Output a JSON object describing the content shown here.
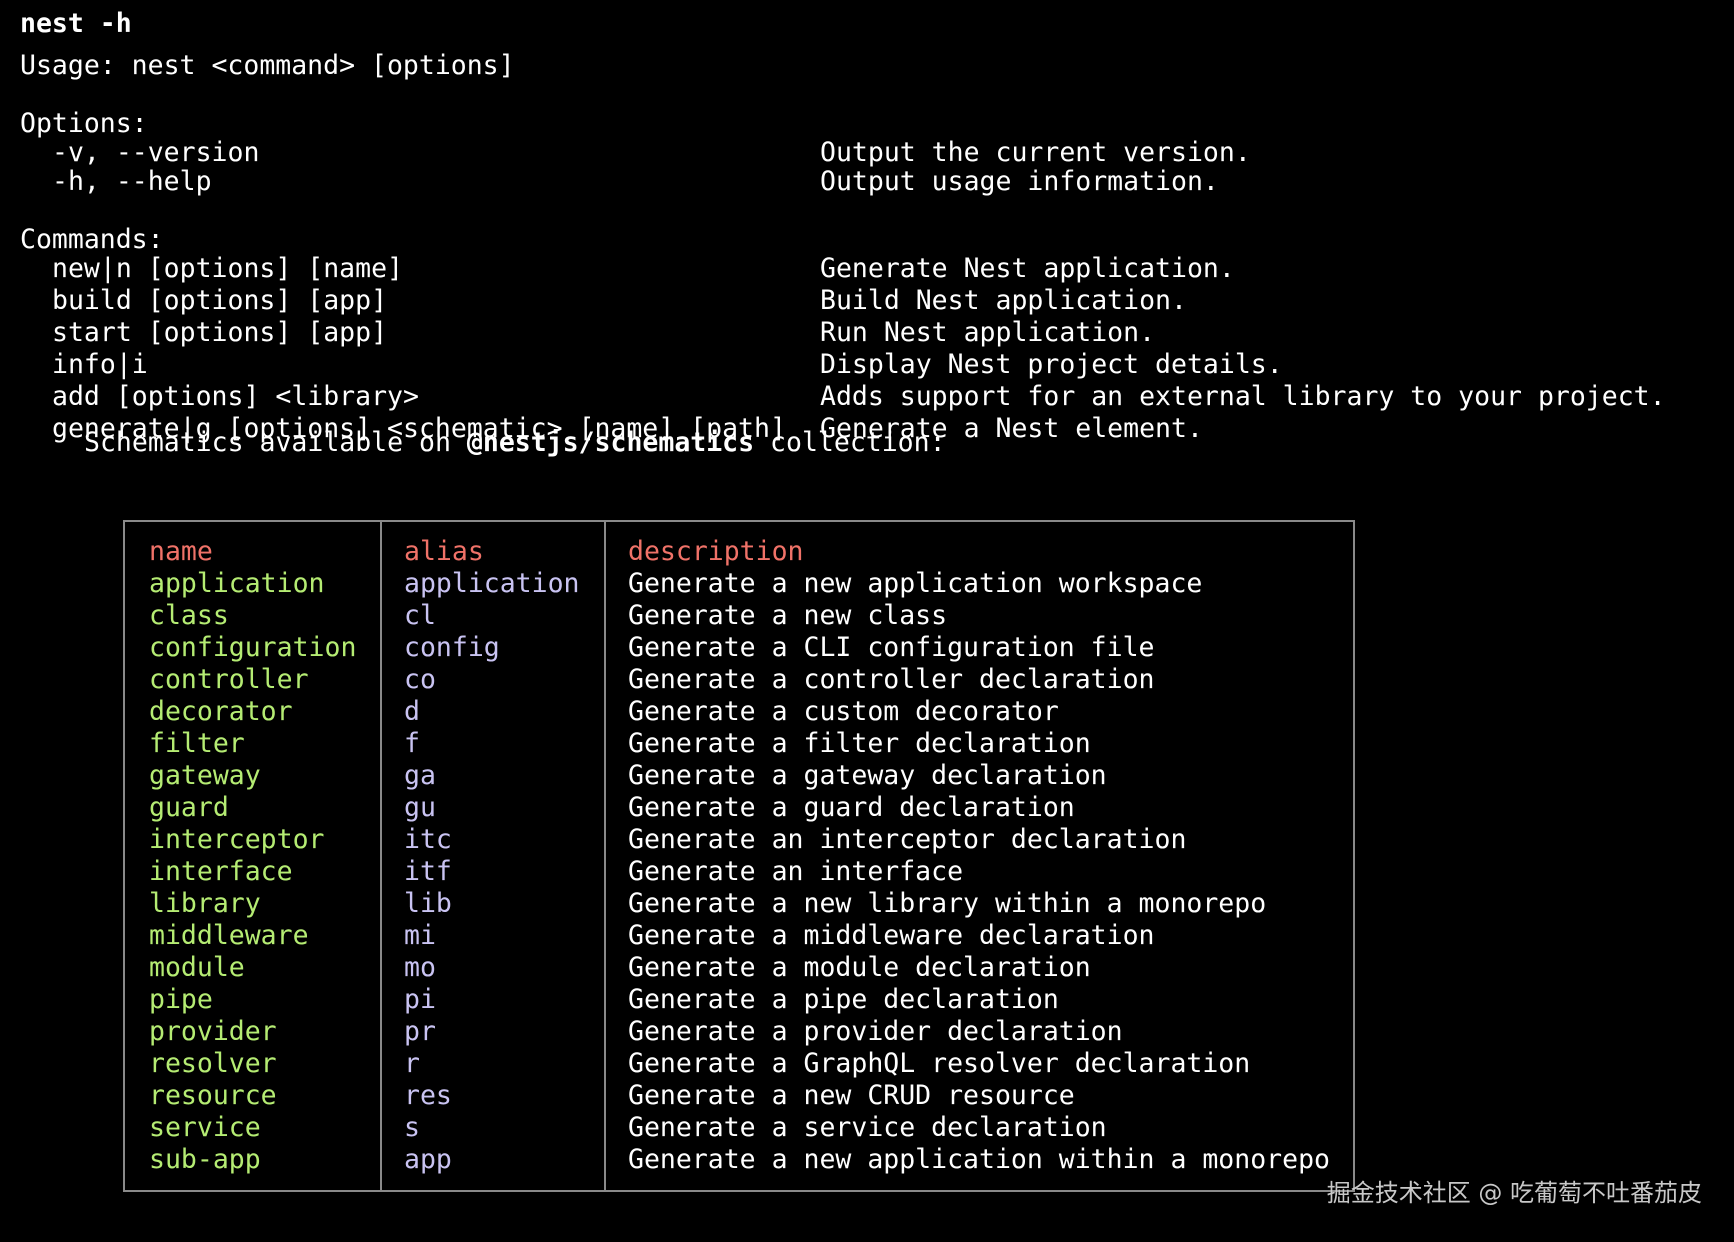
{
  "command": "nest -h",
  "usage": "Usage: nest <command> [options]",
  "options_header": "Options:",
  "options": [
    {
      "flag": "-v, --version",
      "description": "Output the current version."
    },
    {
      "flag": "-h, --help",
      "description": "Output usage information."
    }
  ],
  "commands_header": "Commands:",
  "commands": [
    {
      "usage": "new|n [options] [name]",
      "description": "Generate Nest application."
    },
    {
      "usage": "build [options] [app]",
      "description": "Build Nest application."
    },
    {
      "usage": "start [options] [app]",
      "description": "Run Nest application."
    },
    {
      "usage": "info|i",
      "description": "Display Nest project details."
    },
    {
      "usage": "add [options] <library>",
      "description": "Adds support for an external library to your project."
    },
    {
      "usage": "generate|g [options] <schematic> [name] [path]",
      "description": "Generate a Nest element."
    }
  ],
  "schematics_note": {
    "prefix": "Schematics available on ",
    "collection": "@nestjs/schematics",
    "suffix": " collection:"
  },
  "schematics_table": {
    "headers": {
      "name": "name",
      "alias": "alias",
      "description": "description"
    },
    "rows": [
      {
        "name": "application",
        "alias": "application",
        "description": "Generate a new application workspace"
      },
      {
        "name": "class",
        "alias": "cl",
        "description": "Generate a new class"
      },
      {
        "name": "configuration",
        "alias": "config",
        "description": "Generate a CLI configuration file"
      },
      {
        "name": "controller",
        "alias": "co",
        "description": "Generate a controller declaration"
      },
      {
        "name": "decorator",
        "alias": "d",
        "description": "Generate a custom decorator"
      },
      {
        "name": "filter",
        "alias": "f",
        "description": "Generate a filter declaration"
      },
      {
        "name": "gateway",
        "alias": "ga",
        "description": "Generate a gateway declaration"
      },
      {
        "name": "guard",
        "alias": "gu",
        "description": "Generate a guard declaration"
      },
      {
        "name": "interceptor",
        "alias": "itc",
        "description": "Generate an interceptor declaration"
      },
      {
        "name": "interface",
        "alias": "itf",
        "description": "Generate an interface"
      },
      {
        "name": "library",
        "alias": "lib",
        "description": "Generate a new library within a monorepo"
      },
      {
        "name": "middleware",
        "alias": "mi",
        "description": "Generate a middleware declaration"
      },
      {
        "name": "module",
        "alias": "mo",
        "description": "Generate a module declaration"
      },
      {
        "name": "pipe",
        "alias": "pi",
        "description": "Generate a pipe declaration"
      },
      {
        "name": "provider",
        "alias": "pr",
        "description": "Generate a provider declaration"
      },
      {
        "name": "resolver",
        "alias": "r",
        "description": "Generate a GraphQL resolver declaration"
      },
      {
        "name": "resource",
        "alias": "res",
        "description": "Generate a new CRUD resource"
      },
      {
        "name": "service",
        "alias": "s",
        "description": "Generate a service declaration"
      },
      {
        "name": "sub-app",
        "alias": "app",
        "description": "Generate a new application within a monorepo"
      }
    ]
  },
  "watermark": "掘金技术社区 @ 吃葡萄不吐番茄皮",
  "colors": {
    "background": "#000000",
    "text": "#ffffff",
    "header": "#f07268",
    "name": "#b5ec73",
    "alias": "#c9c3f2",
    "border": "#8a8a8a"
  }
}
